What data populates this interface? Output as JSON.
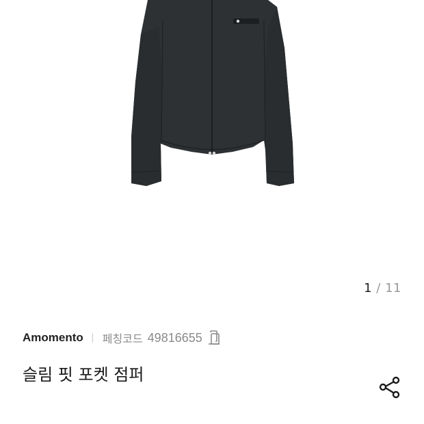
{
  "gallery": {
    "current": "1",
    "separator": "/",
    "total": "11"
  },
  "product": {
    "brand": "Amomento",
    "code_label": "페칭코드",
    "code_value": "49816655",
    "title": "슬림 핏 포켓 점퍼"
  },
  "icons": {
    "copy": "copy-icon",
    "share": "share-icon"
  },
  "colors": {
    "jacket": "#2e3133",
    "text_primary": "#222222",
    "text_secondary": "#8a8a8a"
  }
}
